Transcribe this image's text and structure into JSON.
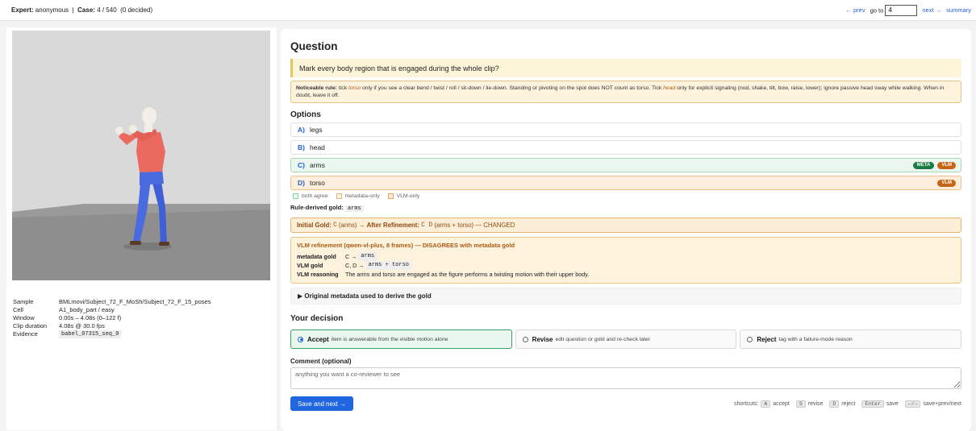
{
  "topbar": {
    "expert_label": "Expert:",
    "expert_value": "anonymous",
    "case_label": "Case:",
    "case_value": "4 / 540",
    "decided": "(0 decided)",
    "prev": "← prev",
    "goto_label": "go to",
    "goto_value": "4",
    "next": "next →",
    "summary": "summary"
  },
  "meta": [
    {
      "key": "Sample",
      "value": "BMLmovi/Subject_72_F_MoSh/Subject_72_F_15_poses"
    },
    {
      "key": "Cell",
      "value": "A1_body_part / easy"
    },
    {
      "key": "Window",
      "value": "0.00s – 4.08s (0–122 f)"
    },
    {
      "key": "Clip duration",
      "value": "4.08s @ 30.0 fps"
    },
    {
      "key": "Evidence",
      "value": "babel_07315_seq_0"
    }
  ],
  "question": {
    "heading": "Question",
    "text": "Mark every body region that is engaged during the whole clip?",
    "rule_label": "Noticeable rule:",
    "rule_p1": " tick ",
    "rule_torso": "torso",
    "rule_p2": " only if you see a clear bend / twist / roll / sit-down / lie-down. Standing or pivoting on the spot does NOT count as torso. Tick ",
    "rule_head": "head",
    "rule_p3": " only for explicit signaling (nod, shake, tilt, bow, raise, lower); ignore passive head sway while walking. When in doubt, leave it off."
  },
  "options": {
    "heading": "Options",
    "items": [
      {
        "letter": "A)",
        "label": "legs"
      },
      {
        "letter": "B)",
        "label": "head"
      },
      {
        "letter": "C)",
        "label": "arms"
      },
      {
        "letter": "D)",
        "label": "torso"
      }
    ],
    "badge_meta": "META",
    "badge_vlm": "VLM",
    "legend_both": "both agree",
    "legend_meta": "metadata-only",
    "legend_vlm": "VLM-only"
  },
  "gold": {
    "rule_label": "Rule-derived gold:",
    "rule_value": "arms",
    "initial_label": "Initial Gold:",
    "initial_code": "C",
    "initial_text": "(arms) →",
    "after_label": "After Refinement:",
    "after_code": "C D",
    "after_text": "(arms + torso) — CHANGED"
  },
  "vlm": {
    "title": "VLM refinement (qwen-vl-plus, 8 frames) — DISAGREES with metadata gold",
    "meta_key": "metadata gold",
    "meta_prefix": "C →",
    "meta_code": "arms",
    "gold_key": "VLM gold",
    "gold_prefix": "C, D →",
    "gold_code": "arms + torso",
    "reason_key": "VLM reasoning",
    "reason_text": "The arms and torso are engaged as the figure performs a twisting motion with their upper body."
  },
  "details": "▶ Original metadata used to derive the gold",
  "decision": {
    "heading": "Your decision",
    "accept_label": "Accept",
    "accept_desc": "item is answerable from the visible motion alone",
    "revise_label": "Revise",
    "revise_desc": "edit question or gold and re-check later",
    "reject_label": "Reject",
    "reject_desc": "tag with a failure-mode reason"
  },
  "comment": {
    "label": "Comment (optional)",
    "placeholder": "anything you want a co-reviewer to see"
  },
  "save_label": "Save and next →",
  "shortcuts": {
    "label": "shortcuts:",
    "k_accept": "A",
    "accept": "accept",
    "k_revise": "S",
    "revise": "revise",
    "k_reject": "D",
    "reject": "reject",
    "k_enter": "Enter",
    "save": "save",
    "k_arrows": "←/→",
    "nav": "save+prev/next"
  },
  "colors": {
    "accent": "#1f66e0",
    "agree": "#e9f7ee",
    "vlm_only": "#fdeedd"
  }
}
